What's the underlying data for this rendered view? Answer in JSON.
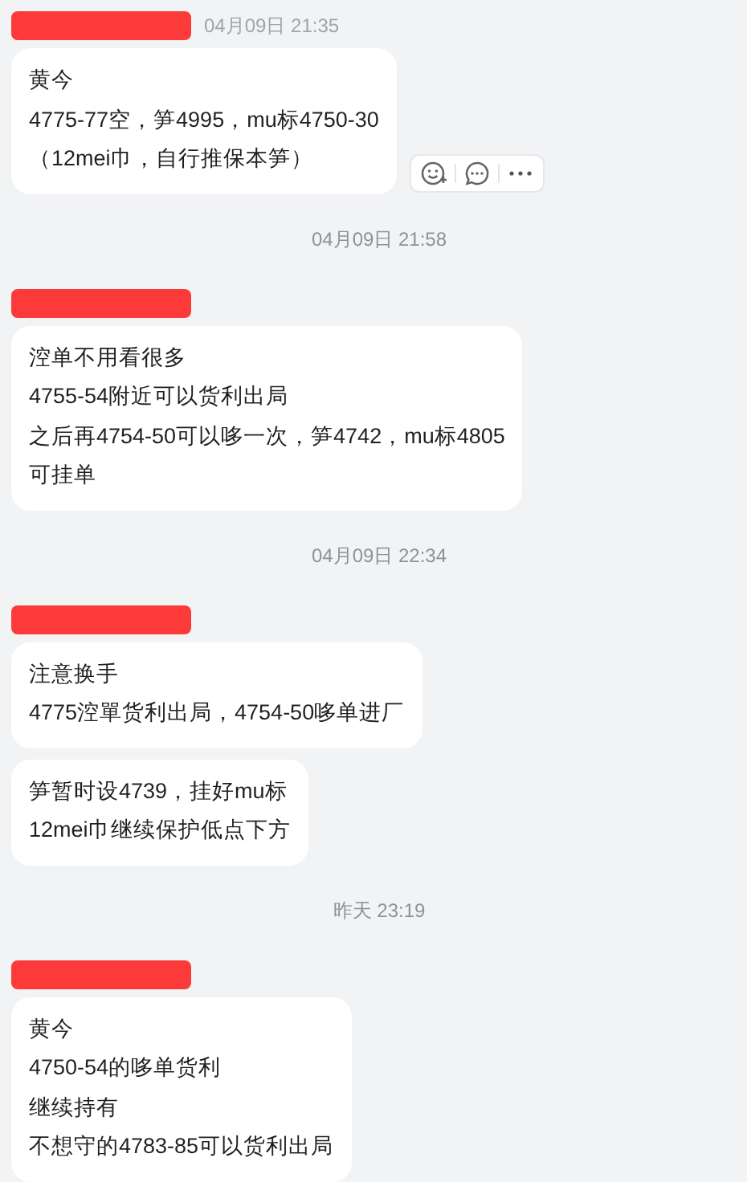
{
  "items": [
    {
      "kind": "message",
      "time": "04月09日 21:35",
      "bubbles": [
        {
          "lines": [
            "黄今",
            "4775-77空，笋4995，mu标4750-30",
            "（12mei巾，自行推保本笋）"
          ]
        }
      ],
      "actions": true
    },
    {
      "kind": "time",
      "text": "04月09日 21:58"
    },
    {
      "kind": "message",
      "bubbles": [
        {
          "lines": [
            "涳单不用看很多",
            "4755-54附近可以货利出局",
            "之后再4754-50可以哆一次，笋4742，mu标4805",
            "可挂单"
          ]
        }
      ],
      "actions": false
    },
    {
      "kind": "time",
      "text": "04月09日 22:34"
    },
    {
      "kind": "message",
      "bubbles": [
        {
          "lines": [
            "注意换手",
            "4775涳單货利出局，4754-50哆单进厂"
          ]
        },
        {
          "lines": [
            "笋暂时设4739，挂好mu标",
            "12mei巾继续保护低点下方"
          ]
        }
      ],
      "actions": false
    },
    {
      "kind": "time",
      "text": "昨天 23:19"
    },
    {
      "kind": "message",
      "bubbles": [
        {
          "lines": [
            "黄今",
            "4750-54的哆单货利",
            "继续持有",
            "不想守的4783-85可以货利出局"
          ]
        }
      ],
      "actions": false
    }
  ]
}
